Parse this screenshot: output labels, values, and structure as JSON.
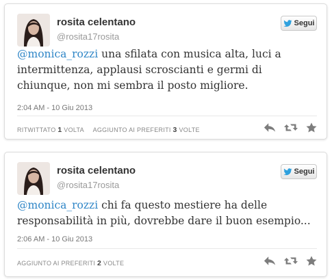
{
  "colors": {
    "mention": "#2f86c7",
    "icon_gray": "#7d7d7d",
    "follow_bird": "#2fa1de"
  },
  "tweets": [
    {
      "name": "rosita celentano",
      "handle": "@rosita17rosita",
      "follow_label": "Segui",
      "mention": "@monica_rozzi",
      "text": " una sfilata con musica alta, luci a intermittenza, applausi scroscianti e germi di chiunque, non mi sembra il posto migliore.",
      "timestamp": "2:04 AM - 10 Giu 2013",
      "retweet_prefix": "Ritwittato",
      "retweet_count": "1",
      "retweet_suffix": "volta",
      "fav_prefix": "Aggiunto ai preferiti",
      "fav_count": "3",
      "fav_suffix": "volte",
      "icons": [
        "reply-icon",
        "retweet-icon",
        "favorite-icon"
      ]
    },
    {
      "name": "rosita celentano",
      "handle": "@rosita17rosita",
      "follow_label": "Segui",
      "mention": "@monica_rozzi",
      "text": " chi fa questo mestiere ha delle responsabilità in più, dovrebbe dare il buon esempio...",
      "timestamp": "2:06 AM - 10 Giu 2013",
      "fav_prefix": "Aggiunto ai preferiti",
      "fav_count": "2",
      "fav_suffix": "volte",
      "icons": [
        "reply-icon",
        "retweet-icon",
        "favorite-icon"
      ]
    }
  ]
}
